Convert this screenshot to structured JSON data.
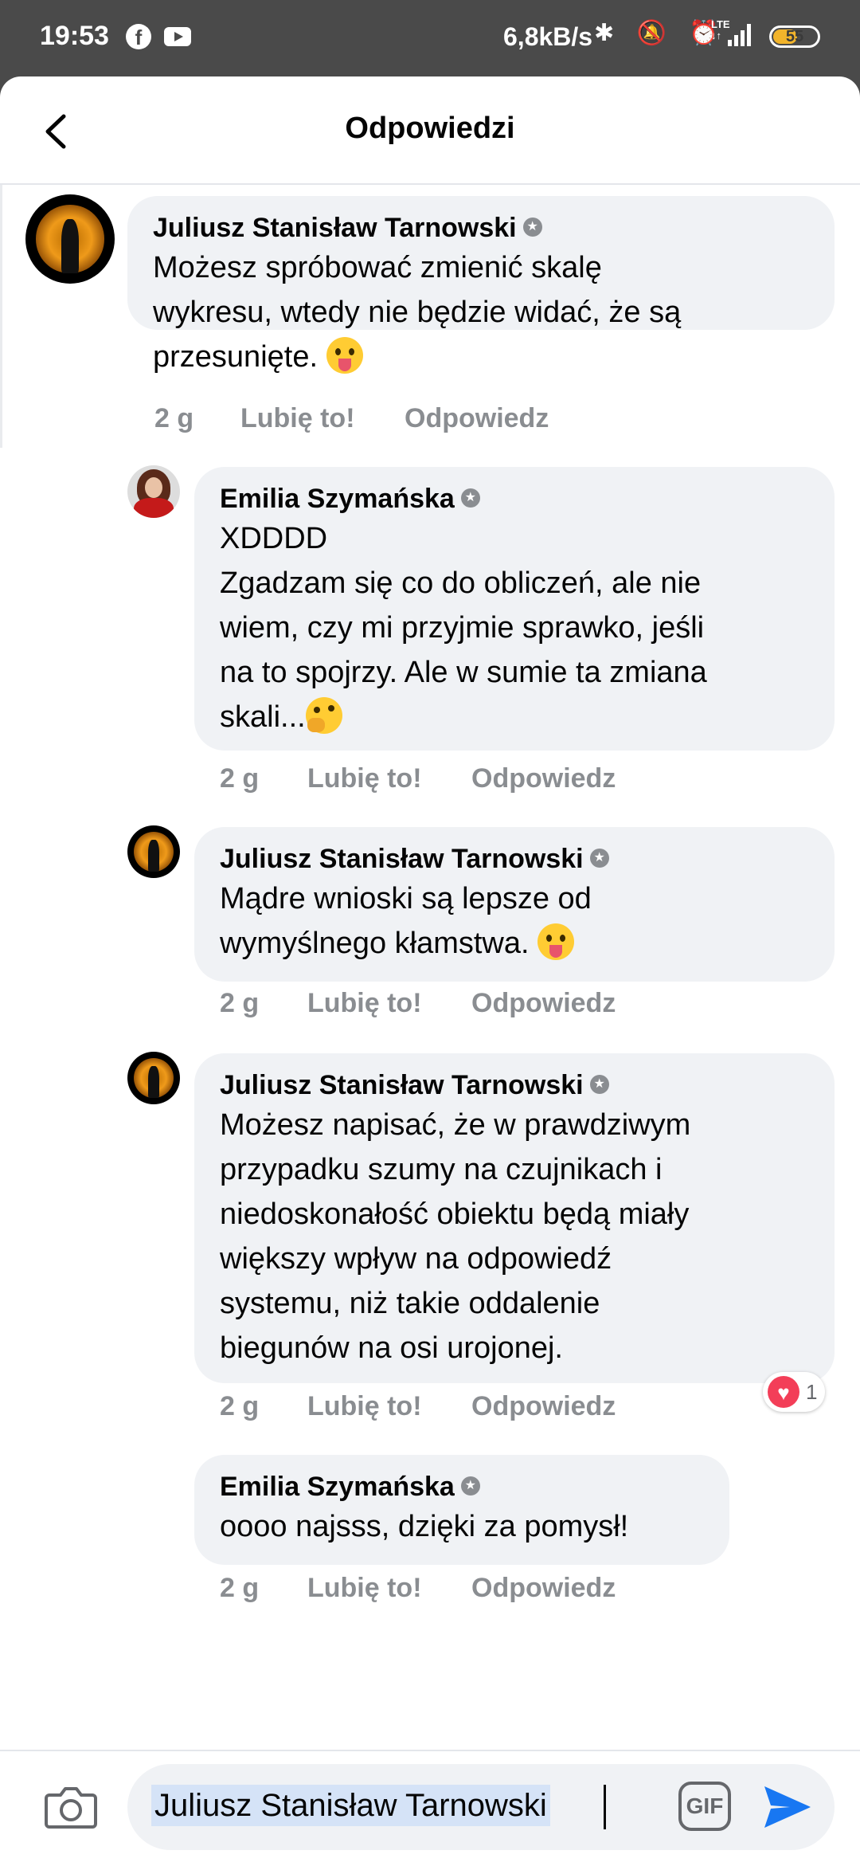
{
  "status_bar": {
    "time": "19:53",
    "fb_glyph": "f",
    "speed": "6,8kB/s",
    "icons": "✱ 🔕 ⏰",
    "network_top": "LTE",
    "network_bottom": "↓↑",
    "battery": "55"
  },
  "header": {
    "title": "Odpowiedzi"
  },
  "comments": [
    {
      "author": "Juliusz Stanisław Tarnowski",
      "lines": "Możesz spróbować zmienić skalę\nwykresu, wtedy nie będzie widać, że są\nprzesunięte. ",
      "time": "2 g",
      "like": "Lubię to!",
      "reply": "Odpowiedz"
    },
    {
      "author": "Emilia Szymańska",
      "lines": "XDDDD\nZgadzam się co do obliczeń, ale nie\nwiem, czy mi przyjmie sprawko, jeśli\nna to spojrzy. Ale w sumie ta zmiana\nskali...",
      "time": "2 g",
      "like": "Lubię to!",
      "reply": "Odpowiedz"
    },
    {
      "author": "Juliusz Stanisław Tarnowski",
      "lines": "Mądre wnioski są lepsze od\nwymyślnego kłamstwa. ",
      "time": "2 g",
      "like": "Lubię to!",
      "reply": "Odpowiedz"
    },
    {
      "author": "Juliusz Stanisław Tarnowski",
      "lines": "Możesz napisać, że w prawdziwym\nprzypadku szumy na czujnikach i\nniedoskonałość obiektu będą miały\nwiększy wpływ na odpowiedź\nsystemu, niż takie oddalenie\nbiegunów na osi urojonej.",
      "time": "2 g",
      "like": "Lubię to!",
      "reply": "Odpowiedz",
      "reaction_icon": "♥",
      "reaction_count": "1"
    },
    {
      "author": "Emilia Szymańska",
      "lines": "oooo najsss, dzięki za pomysł!",
      "time": "2 g",
      "like": "Lubię to!",
      "reply": "Odpowiedz"
    }
  ],
  "composer": {
    "input_value": "Juliusz Stanisław Tarnowski",
    "gif_label": "GIF"
  },
  "colors": {
    "status_bar_bg": "#4a4a4a",
    "bubble_bg": "#f0f2f5",
    "meta_text": "#8a8d91",
    "send_blue": "#1877f2",
    "heart_red": "#f33e58",
    "battery_yellow": "#f2b42b"
  },
  "icons": {
    "back": "back-arrow-icon",
    "camera": "camera-icon",
    "gif": "gif-icon",
    "send": "send-icon",
    "verified": "badge-icon",
    "emoji_tongue": "tongue-emoji",
    "emoji_think": "thinking-emoji"
  }
}
